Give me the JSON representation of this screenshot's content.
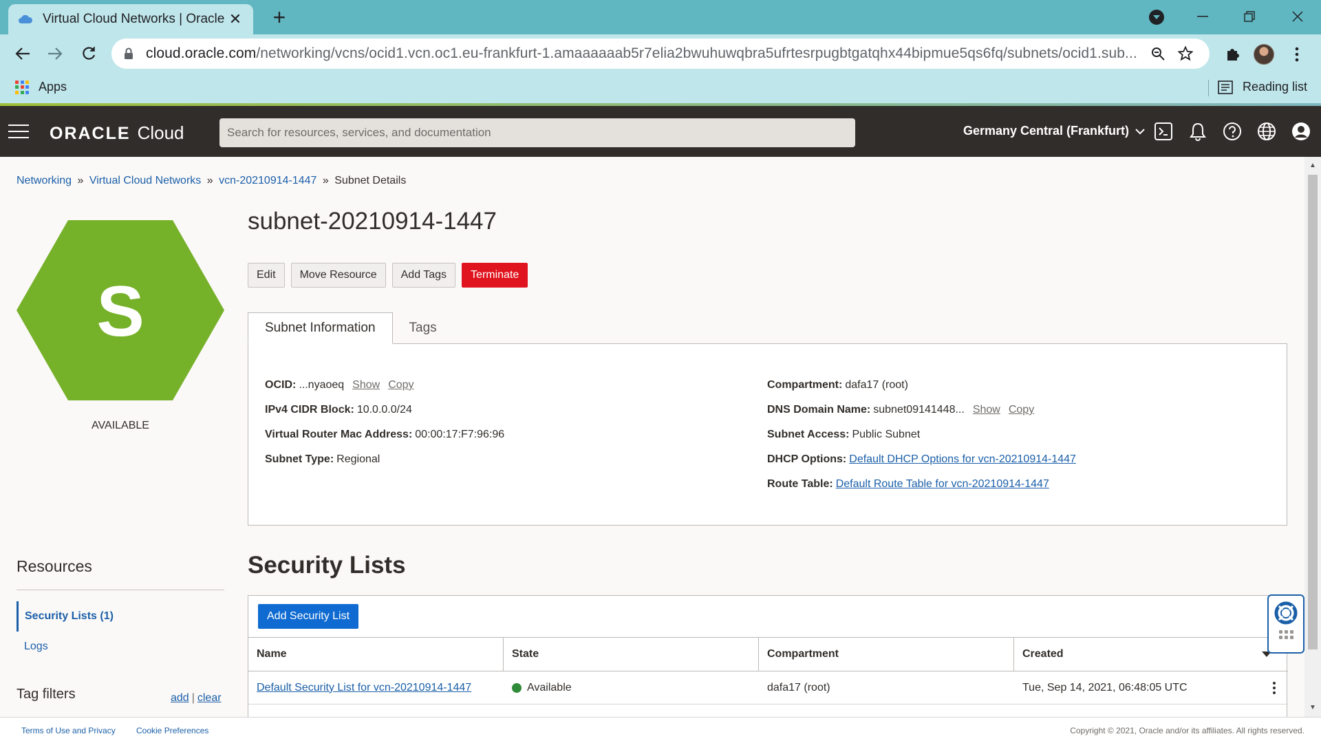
{
  "browser": {
    "tab_title": "Virtual Cloud Networks | Oracle C",
    "url_host": "cloud.oracle.com",
    "url_path": "/networking/vcns/ocid1.vcn.oc1.eu-frankfurt-1.amaaaaaab5r7elia2bwuhuwqbra5ufrtesrpugbtgatqhx44bipmue5qs6fq/subnets/ocid1.sub...",
    "apps_label": "Apps",
    "reading_list_label": "Reading list"
  },
  "header": {
    "brand": "ORACLE",
    "product": "Cloud",
    "search_placeholder": "Search for resources, services, and documentation",
    "region": "Germany Central (Frankfurt)"
  },
  "breadcrumb": {
    "items": [
      "Networking",
      "Virtual Cloud Networks",
      "vcn-20210914-1447"
    ],
    "separator": "»",
    "current": "Subnet Details"
  },
  "resource_icon": {
    "letter": "S",
    "status": "AVAILABLE",
    "color": "#76b12a"
  },
  "page": {
    "title": "subnet-20210914-1447",
    "actions": {
      "edit": "Edit",
      "move": "Move Resource",
      "add_tags": "Add Tags",
      "terminate": "Terminate"
    },
    "tabs": [
      "Subnet Information",
      "Tags"
    ]
  },
  "subnet_info": {
    "ocid_label": "OCID:",
    "ocid_value": "...nyaoeq",
    "show": "Show",
    "copy": "Copy",
    "cidr_label": "IPv4 CIDR Block:",
    "cidr_value": "10.0.0.0/24",
    "mac_label": "Virtual Router Mac Address:",
    "mac_value": "00:00:17:F7:96:96",
    "type_label": "Subnet Type:",
    "type_value": "Regional",
    "compartment_label": "Compartment:",
    "compartment_value": "dafa17 (root)",
    "dns_label": "DNS Domain Name:",
    "dns_value": "subnet09141448...",
    "access_label": "Subnet Access:",
    "access_value": "Public Subnet",
    "dhcp_label": "DHCP Options:",
    "dhcp_value": "Default DHCP Options for vcn-20210914-1447",
    "route_label": "Route Table:",
    "route_value": "Default Route Table for vcn-20210914-1447"
  },
  "resources": {
    "title": "Resources",
    "active_item": "Security Lists (1)",
    "item": "Logs",
    "tag_filters": "Tag filters",
    "add": "add",
    "sep": "|",
    "clear": "clear"
  },
  "security_lists": {
    "title": "Security Lists",
    "add_button": "Add Security List",
    "columns": [
      "Name",
      "State",
      "Compartment",
      "Created"
    ],
    "rows": [
      {
        "name": "Default Security List for vcn-20210914-1447",
        "state": "Available",
        "compartment": "dafa17 (root)",
        "created": "Tue, Sep 14, 2021, 06:48:05 UTC"
      }
    ]
  },
  "footer": {
    "terms": "Terms of Use and Privacy",
    "cookies": "Cookie Preferences",
    "copyright": "Copyright © 2021, Oracle and/or its affiliates. All rights reserved."
  }
}
